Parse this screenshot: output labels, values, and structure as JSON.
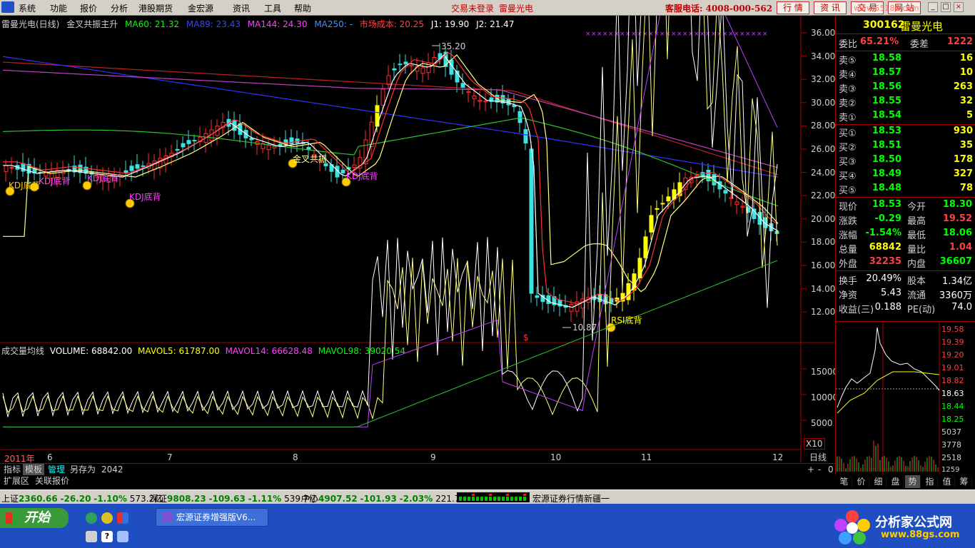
{
  "menubar": {
    "items": [
      "系统",
      "功能",
      "报价",
      "分析",
      "港股期货",
      "金宏源",
      "资讯",
      "工具",
      "帮助"
    ],
    "status_message": "交易未登录",
    "stock_name_header": "雷曼光电",
    "hotline": "客服电话: 4008-000-562",
    "buttons": [
      "行 情",
      "资 讯",
      "交 易",
      "网 站"
    ],
    "watermark": "www.55188.com"
  },
  "chart_header": {
    "title": "雷曼光电(日线)",
    "indicator_name": "金叉共振主升",
    "ma60": "MA60: 21.32",
    "ma89": "MA89: 23.43",
    "ma144": "MA144: 24.30",
    "ma250": "MA250: -",
    "market_cost": "市场成本: 20.25",
    "j1": "J1: 19.90",
    "j2": "J2: 21.47"
  },
  "volume_header": {
    "title": "成交量均线",
    "volume": "VOLUME: 68842.00",
    "mavol5": "MAVOL5: 61787.00",
    "mavol14": "MAVOL14: 66628.48",
    "mavol98": "MAVOL98: 39020.54"
  },
  "price_axis": [
    "36.00",
    "34.00",
    "32.00",
    "30.00",
    "28.00",
    "26.00",
    "24.00",
    "22.00",
    "20.00",
    "18.00",
    "16.00",
    "14.00",
    "12.00"
  ],
  "volume_axis": [
    "15000",
    "10000",
    "5000"
  ],
  "volume_unit": "X10",
  "date_axis": [
    "2011年",
    "6",
    "7",
    "8",
    "9",
    "10",
    "11",
    "12"
  ],
  "annotations": {
    "high": "35.20",
    "low": "10.87",
    "kdj1": "KDJ底背",
    "kdj2": "KDJ底背",
    "kdj3": "KDJ底背",
    "kdj4": "KDJ底背",
    "golden_cross": "金叉共振",
    "rsi": "RSI底背",
    "overlap": "KDJ底背",
    "dollar": "$"
  },
  "quote": {
    "code": "300162",
    "name": "雷曼光电",
    "weibi_label": "委比",
    "weibi": "65.21%",
    "weicha_label": "委差",
    "weicha": "1222",
    "asks": [
      {
        "label": "卖⑤",
        "price": "18.58",
        "vol": "16"
      },
      {
        "label": "卖④",
        "price": "18.57",
        "vol": "10"
      },
      {
        "label": "卖③",
        "price": "18.56",
        "vol": "263"
      },
      {
        "label": "卖②",
        "price": "18.55",
        "vol": "32"
      },
      {
        "label": "卖①",
        "price": "18.54",
        "vol": "5"
      }
    ],
    "bids": [
      {
        "label": "买①",
        "price": "18.53",
        "vol": "930"
      },
      {
        "label": "买②",
        "price": "18.51",
        "vol": "35"
      },
      {
        "label": "买③",
        "price": "18.50",
        "vol": "178"
      },
      {
        "label": "买④",
        "price": "18.49",
        "vol": "327"
      },
      {
        "label": "买⑤",
        "price": "18.48",
        "vol": "78"
      }
    ],
    "stats": {
      "xianjia_l": "现价",
      "xianjia": "18.53",
      "jinkai_l": "今开",
      "jinkai": "18.30",
      "zhangdie_l": "涨跌",
      "zhangdie": "-0.29",
      "zuigao_l": "最高",
      "zuigao": "19.52",
      "zhangfu_l": "涨幅",
      "zhangfu": "-1.54%",
      "zuidi_l": "最低",
      "zuidi": "18.06",
      "zongliang_l": "总量",
      "zongliang": "68842",
      "liangbi_l": "量比",
      "liangbi": "1.04",
      "waipan_l": "外盘",
      "waipan": "32235",
      "neipan_l": "内盘",
      "neipan": "36607",
      "huanshou_l": "换手",
      "huanshou": "20.49%",
      "guben_l": "股本",
      "guben": "1.34亿",
      "jingzi_l": "净资",
      "jingzi": "5.43",
      "liutong_l": "流通",
      "liutong": "3360万",
      "shouyi_l": "收益(三)",
      "shouyi": "0.188",
      "pe_l": "PE(动)",
      "pe": "74.0"
    }
  },
  "mini_axis": [
    "19.58",
    "19.39",
    "19.20",
    "19.01",
    "18.82",
    "18.63",
    "18.44",
    "18.25",
    "5037",
    "3778",
    "2518",
    "1259"
  ],
  "bottom_tabs": [
    "指标",
    "模板",
    "管理",
    "另存为",
    "2042"
  ],
  "bottom_tabs2": [
    "扩展区",
    "关联报价"
  ],
  "daily_label": "日线",
  "zoom_controls": [
    "+",
    "-",
    "0"
  ],
  "right_tabs": [
    "笔",
    "价",
    "细",
    "盘",
    "势",
    "指",
    "值",
    "筹"
  ],
  "statusbar": {
    "sh_label": "上证",
    "sh_val": "2360.66",
    "sh_chg": "-26.20",
    "sh_pct": "-1.10%",
    "sh_amt": "573.2亿",
    "sz_label": "深证",
    "sz_val": "9808.23",
    "sz_chg": "-109.63",
    "sz_pct": "-1.11%",
    "sz_amt": "539.7亿",
    "zx_label": "中小",
    "zx_val": "4907.52",
    "zx_chg": "-101.93",
    "zx_pct": "-2.03%",
    "zx_amt": "221.7亿",
    "news": "宏源证券行情新疆一"
  },
  "taskbar": {
    "start": "开始",
    "task": "宏源证券增强版V6...",
    "brand1": "分析家公式网",
    "brand2": "www.88gs.com"
  }
}
